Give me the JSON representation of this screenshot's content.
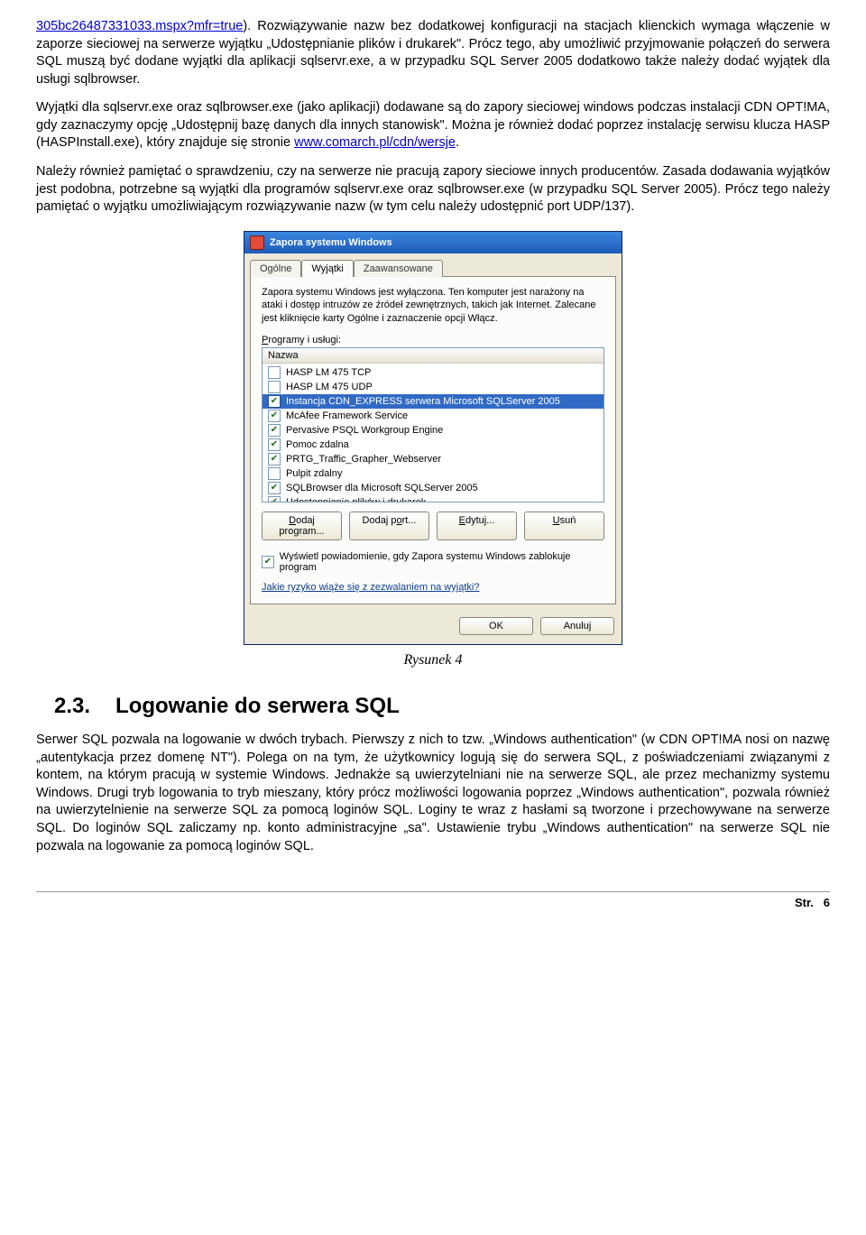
{
  "top_link": "305bc26487331033.mspx?mfr=true",
  "para1_a": "). Rozwiązywanie nazw bez dodatkowej konfiguracji na stacjach klienckich wymaga włączenie w zaporze sieciowej na serwerze wyjątku „Udostępnianie plików i drukarek\". Prócz tego, aby umożliwić przyjmowanie połączeń do serwera SQL muszą być dodane wyjątki dla aplikacji sqlservr.exe, a w przypadku SQL Server 2005 dodatkowo także należy dodać wyjątek dla usługi sqlbrowser.",
  "para2_a": "Wyjątki dla sqlservr.exe oraz sqlbrowser.exe (jako aplikacji) dodawane są do zapory sieciowej windows podczas instalacji CDN OPT!MA, gdy zaznaczymy opcję „Udostępnij bazę danych dla innych stanowisk\". Można je również dodać poprzez instalację serwisu klucza HASP (HASPInstall.exe), który znajduje się stronie ",
  "para2_link": "www.comarch.pl/cdn/wersje",
  "para2_b": ".",
  "para3": "Należy również pamiętać o sprawdzeniu, czy na serwerze nie pracują zapory sieciowe innych producentów. Zasada dodawania wyjątków jest podobna, potrzebne są wyjątki dla programów sqlservr.exe oraz sqlbrowser.exe (w przypadku SQL Server 2005). Prócz tego należy pamiętać o wyjątku umożliwiającym rozwiązywanie nazw (w tym celu należy udostępnić port UDP/137).",
  "caption": "Rysunek 4",
  "section_num": "2.3.",
  "section_title": "Logowanie do serwera SQL",
  "para4": "Serwer SQL pozwala na logowanie w dwóch trybach. Pierwszy z nich to tzw. „Windows authentication\" (w CDN OPT!MA nosi on nazwę „autentykacja przez domenę NT\"). Polega on na tym, że użytkownicy logują się do serwera SQL, z poświadczeniami związanymi z kontem, na którym pracują w systemie Windows. Jednakże są uwierzytelniani nie na serwerze SQL, ale przez mechanizmy systemu Windows. Drugi tryb logowania to tryb mieszany, który prócz możliwości logowania poprzez „Windows authentication\", pozwala również na uwierzytelnienie na serwerze SQL za pomocą loginów SQL. Loginy te wraz z hasłami są tworzone i przechowywane na serwerze SQL. Do loginów SQL zaliczamy np. konto administracyjne „sa\". Ustawienie trybu „Windows authentication\" na serwerze SQL nie pozwala na logowanie za pomocą loginów SQL.",
  "footer_label": "Str.",
  "footer_page": "6",
  "dialog": {
    "title": "Zapora systemu Windows",
    "tabs": {
      "general": "Ogólne",
      "exceptions": "Wyjątki",
      "advanced": "Zaawansowane"
    },
    "info": "Zapora systemu Windows jest wyłączona. Ten komputer jest narażony na ataki i dostęp intruzów ze źródeł zewnętrznych, takich jak Internet. Zalecane jest kliknięcie karty Ogólne i zaznaczenie opcji Włącz.",
    "list_label_pre": "P",
    "list_label_rest": "rogramy i usługi:",
    "col_header": "Nazwa",
    "items": [
      {
        "checked": false,
        "label": "HASP LM 475 TCP"
      },
      {
        "checked": false,
        "label": "HASP LM 475 UDP"
      },
      {
        "checked": true,
        "label": "Instancja CDN_EXPRESS serwera Microsoft SQLServer 2005",
        "selected": true
      },
      {
        "checked": true,
        "label": "McAfee Framework Service"
      },
      {
        "checked": true,
        "label": "Pervasive PSQL Workgroup Engine"
      },
      {
        "checked": true,
        "label": "Pomoc zdalna"
      },
      {
        "checked": true,
        "label": "PRTG_Traffic_Grapher_Webserver"
      },
      {
        "checked": false,
        "label": "Pulpit zdalny"
      },
      {
        "checked": true,
        "label": "SQLBrowser dla Microsoft SQLServer 2005"
      },
      {
        "checked": true,
        "label": "Udostępnianie plików i drukarek"
      }
    ],
    "btn_add_prog_pre": "D",
    "btn_add_prog_rest": "odaj program...",
    "btn_add_port_pre": "Dodaj p",
    "btn_add_port_u": "o",
    "btn_add_port_rest": "rt...",
    "btn_edit_u": "E",
    "btn_edit_rest": "dytuj...",
    "btn_del_u": "U",
    "btn_del_rest": "suń",
    "notify_pre": "W",
    "notify_rest": "yświetl powiadomienie, gdy Zapora systemu Windows zablokuje program",
    "risk_link": "Jakie ryzyko wiąże się z zezwalaniem na wyjątki?",
    "ok": "OK",
    "cancel": "Anuluj"
  }
}
